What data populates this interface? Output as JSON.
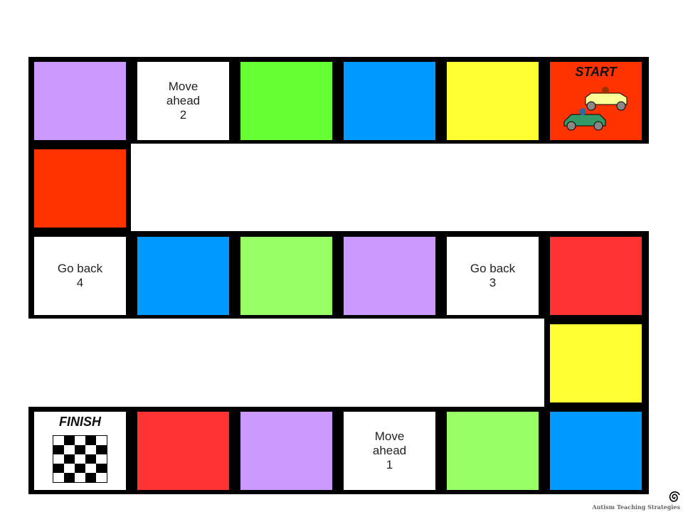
{
  "colors": {
    "purple": "#cc99ff",
    "green": "#66ff33",
    "lightgreen": "#99ff66",
    "blue": "#0099ff",
    "yellow": "#ffff33",
    "orange": "#ff3300",
    "red": "#ff3333",
    "white": "#ffffff"
  },
  "rows": [
    {
      "row": 0,
      "cells": [
        {
          "color": "purple"
        },
        {
          "color": "white",
          "text": "Move\nahead\n2"
        },
        {
          "color": "green"
        },
        {
          "color": "blue"
        },
        {
          "color": "yellow"
        },
        {
          "color": "orange",
          "special": "START",
          "icon": "race-cars-icon"
        }
      ]
    },
    {
      "row": 1,
      "cells": [
        {
          "col": 0,
          "color": "orange"
        }
      ]
    },
    {
      "row": 2,
      "cells": [
        {
          "color": "white",
          "text": "Go back\n4"
        },
        {
          "color": "blue"
        },
        {
          "color": "lightgreen"
        },
        {
          "color": "purple"
        },
        {
          "color": "white",
          "text": "Go back\n3"
        },
        {
          "color": "red"
        }
      ]
    },
    {
      "row": 3,
      "cells": [
        {
          "col": 5,
          "color": "yellow"
        }
      ]
    },
    {
      "row": 4,
      "cells": [
        {
          "color": "white",
          "special": "FINISH",
          "icon": "checkered-flag-icon"
        },
        {
          "color": "red"
        },
        {
          "color": "purple"
        },
        {
          "color": "white",
          "text": "Move\nahead\n1"
        },
        {
          "color": "lightgreen"
        },
        {
          "color": "blue"
        }
      ]
    }
  ],
  "logo": {
    "text": "Autism Teaching Strategies",
    "icon": "spiral-icon"
  }
}
